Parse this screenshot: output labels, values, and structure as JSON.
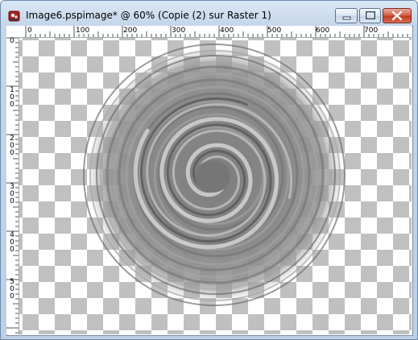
{
  "window": {
    "title": "Image6.pspimage*  @  60% (Copie (2) sur Raster 1)",
    "zoom": "60%",
    "icon": "paint-shop-pro-app-icon",
    "controls": [
      "minimize-icon",
      "maximize-icon",
      "close-icon"
    ]
  },
  "ruler": {
    "horizontal": [
      "0",
      "100",
      "200",
      "300",
      "400",
      "500",
      "600",
      "700"
    ],
    "vertical": [
      "0",
      "100",
      "200",
      "300",
      "400",
      "500"
    ]
  },
  "canvas": {
    "transparency_grid": true,
    "image": "gray-swirl-spiral",
    "colors": {
      "checker_dark": "#c0c0c0",
      "checker_light": "#ffffff",
      "swirl": "#7f7f7f"
    }
  }
}
